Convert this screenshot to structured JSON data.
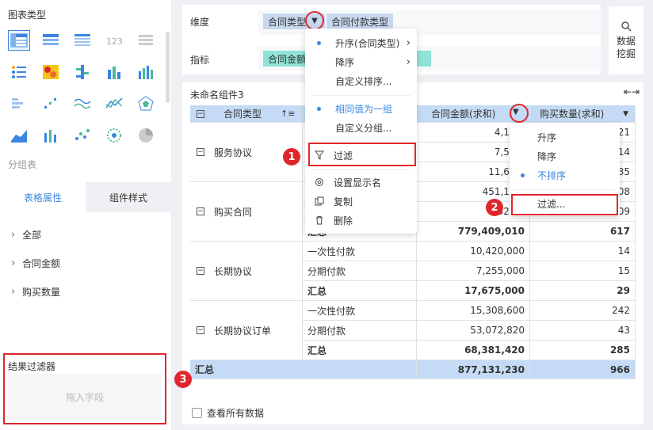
{
  "left": {
    "chart_type_title": "图表类型",
    "group_table_label": "分组表",
    "tabs": [
      {
        "label": "表格属性"
      },
      {
        "label": "组件样式"
      }
    ],
    "fields": [
      {
        "label": "全部"
      },
      {
        "label": "合同金额"
      },
      {
        "label": "购买数量"
      }
    ],
    "result_filter": {
      "title": "结果过滤器",
      "placeholder": "拖入字段"
    }
  },
  "dimension": {
    "label": "维度",
    "pills": [
      "合同类型",
      "合同付款类型"
    ]
  },
  "indicator": {
    "label": "指标",
    "pills": [
      "合同金额"
    ]
  },
  "mining": {
    "label_line1": "数据",
    "label_line2": "挖掘"
  },
  "widget": {
    "title": "未命名组件3"
  },
  "table": {
    "headers": [
      "合同类型",
      "",
      "合同金额(求和)",
      "购买数量(求和)"
    ],
    "groups": [
      {
        "name": "服务协议",
        "rows": [
          {
            "sub": "",
            "amount": "4,155,",
            "qty": "21"
          },
          {
            "sub": "",
            "amount": "7,510,",
            "qty": "14"
          },
          {
            "sub": "",
            "amount": "11,665,",
            "qty": "35"
          }
        ]
      },
      {
        "name": "购买合同",
        "rows": [
          {
            "sub": "",
            "amount": "451,142,",
            "qty": "08"
          },
          {
            "sub": "",
            "amount": "328,2",
            "qty": "09"
          },
          {
            "sub": "汇总",
            "amount": "779,409,010",
            "qty": "617"
          }
        ]
      },
      {
        "name": "长期协议",
        "rows": [
          {
            "sub": "一次性付款",
            "amount": "10,420,000",
            "qty": "14"
          },
          {
            "sub": "分期付款",
            "amount": "7,255,000",
            "qty": "15"
          },
          {
            "sub": "汇总",
            "amount": "17,675,000",
            "qty": "29"
          }
        ]
      },
      {
        "name": "长期协议订单",
        "rows": [
          {
            "sub": "一次性付款",
            "amount": "15,308,600",
            "qty": "242"
          },
          {
            "sub": "分期付款",
            "amount": "53,072,820",
            "qty": "43"
          },
          {
            "sub": "汇总",
            "amount": "68,381,420",
            "qty": "285"
          }
        ]
      }
    ],
    "total": {
      "label": "汇总",
      "amount": "877,131,230",
      "qty": "966"
    }
  },
  "view_all": {
    "label": "查看所有数据"
  },
  "menu1": {
    "items": [
      "升序(合同类型)",
      "降序",
      "自定义排序...",
      "相同值为一组",
      "自定义分组...",
      "过滤",
      "设置显示名",
      "复制",
      "删除"
    ]
  },
  "menu2": {
    "items": [
      "升序",
      "降序",
      "不排序",
      "过滤..."
    ]
  },
  "badges": [
    "1",
    "2",
    "3"
  ],
  "colors": {
    "accent": "#3a86e0",
    "highlight": "#e0262d",
    "header": "#c5dbf5",
    "pill_blue": "#c7d8ef",
    "pill_teal": "#8fe3d8"
  }
}
